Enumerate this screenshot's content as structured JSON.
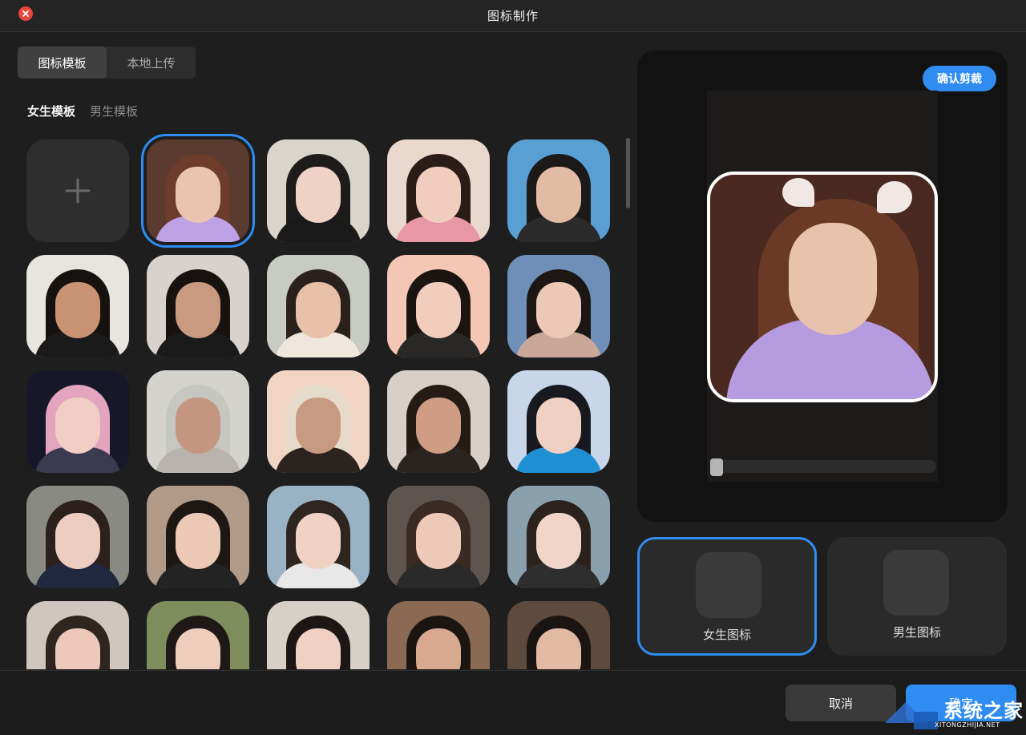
{
  "window": {
    "title": "图标制作"
  },
  "source_tabs": [
    {
      "label": "图标模板",
      "active": true
    },
    {
      "label": "本地上传",
      "active": false
    }
  ],
  "gender_tabs": [
    {
      "label": "女生模板",
      "active": true
    },
    {
      "label": "男生模板",
      "active": false
    }
  ],
  "templates": {
    "add_icon": "plus-icon",
    "selected_index": 0,
    "items": [
      {
        "bg": "#5b3a2f",
        "hair": "#6d3c2a",
        "face": "#e9c4b1",
        "body": "#bfa2e6"
      },
      {
        "bg": "#d9d4cc",
        "hair": "#1e1b1b",
        "face": "#efd2c6",
        "body": "#1a1a1a"
      },
      {
        "bg": "#ead8cd",
        "hair": "#2a1d18",
        "face": "#f1cdbf",
        "body": "#e898a4"
      },
      {
        "bg": "#5a9fd4",
        "hair": "#1c1a19",
        "face": "#e2bba4",
        "body": "#2a2a2a"
      },
      {
        "bg": "#e8e4e0",
        "hair": "#15120f",
        "face": "#c99273",
        "body": "#1a1a1a"
      },
      {
        "bg": "#d8d2ce",
        "hair": "#17120f",
        "face": "#c99a80",
        "body": "#1a1a1a"
      },
      {
        "bg": "#c7cbc4",
        "hair": "#2a211d",
        "face": "#e9c0aa",
        "body": "#efe6dc"
      },
      {
        "bg": "#f4c6b4",
        "hair": "#1b1512",
        "face": "#f0cdbd",
        "body": "#2a2826"
      },
      {
        "bg": "#6e8fb7",
        "hair": "#1c1715",
        "face": "#ecc8b7",
        "body": "#c9a89a"
      },
      {
        "bg": "#16182a",
        "hair": "#e3a4be",
        "face": "#f0cdc5",
        "body": "#3a3a50"
      },
      {
        "bg": "#d5d3cd",
        "hair": "#c7c7c2",
        "face": "#c49680",
        "body": "#b9b3ae"
      },
      {
        "bg": "#f1d4c4",
        "hair": "#e6dbcb",
        "face": "#c99a82",
        "body": "#2b2320"
      },
      {
        "bg": "#d8d0c8",
        "hair": "#241a16",
        "face": "#cf9c84",
        "body": "#2a2421"
      },
      {
        "bg": "#c7d6e8",
        "hair": "#17191e",
        "face": "#efd0c3",
        "body": "#1f8fd4"
      },
      {
        "bg": "#8a8a84",
        "hair": "#2b201b",
        "face": "#edcdbf",
        "body": "#21273e"
      },
      {
        "bg": "#b29a88",
        "hair": "#1d1714",
        "face": "#ecc8b6",
        "body": "#232323"
      },
      {
        "bg": "#9ab3c4",
        "hair": "#2f2520",
        "face": "#f0d2c5",
        "body": "#e8e8e8"
      },
      {
        "bg": "#5e5550",
        "hair": "#3a2a22",
        "face": "#ecc9b9",
        "body": "#2a2a2a"
      },
      {
        "bg": "#8aa0ad",
        "hair": "#2b211d",
        "face": "#f1d5c8",
        "body": "#2e2e2e"
      },
      {
        "bg": "#cfc6bd",
        "hair": "#2f2520",
        "face": "#ecc9ba",
        "body": "#1f1f1f"
      },
      {
        "bg": "#7f8d5c",
        "hair": "#1e1816",
        "face": "#efcdbd",
        "body": "#2a2a2a"
      },
      {
        "bg": "#d6d0c6",
        "hair": "#1c1614",
        "face": "#efd0c3",
        "body": "#2c2c2c"
      },
      {
        "bg": "#8a6a52",
        "hair": "#1b1512",
        "face": "#d8a98e",
        "body": "#e8e2da"
      },
      {
        "bg": "#5f4a3e",
        "hair": "#1a1412",
        "face": "#e2b9a2",
        "body": "#1f1f1f"
      }
    ]
  },
  "preview": {
    "confirm_crop_label": "确认剪裁"
  },
  "icon_types": [
    {
      "label": "女生图标",
      "active": true
    },
    {
      "label": "男生图标",
      "active": false
    }
  ],
  "footer": {
    "cancel_label": "取消",
    "ok_label": "确定"
  },
  "watermark": {
    "text": "系统之家",
    "sub": "XITONGZHIJIA.NET"
  },
  "colors": {
    "accent": "#2f8cf0",
    "close": "#e8453c"
  }
}
